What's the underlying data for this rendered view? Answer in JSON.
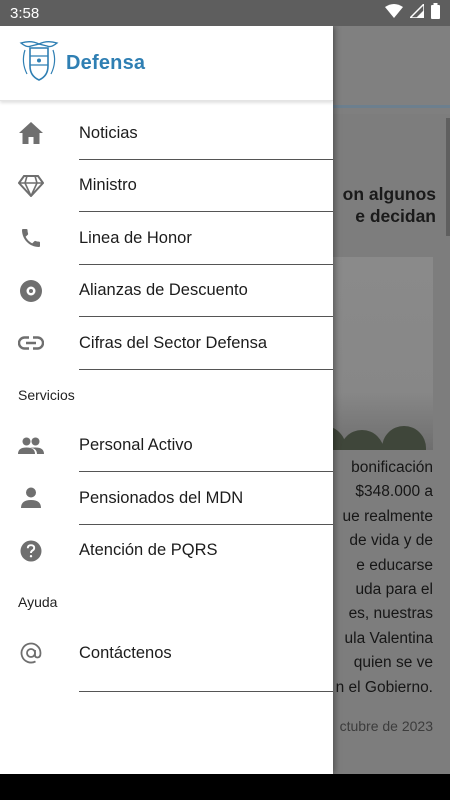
{
  "status_bar": {
    "time": "3:58"
  },
  "drawer": {
    "logo_text": "Defensa",
    "primary_items": [
      {
        "label": "Noticias",
        "icon": "home-icon"
      },
      {
        "label": "Ministro",
        "icon": "diamond-icon"
      },
      {
        "label": "Linea de Honor",
        "icon": "phone-icon"
      },
      {
        "label": "Alianzas de Descuento",
        "icon": "disc-icon"
      },
      {
        "label": "Cifras del Sector Defensa",
        "icon": "link-icon"
      }
    ],
    "servicios_label": "Servicios",
    "servicios_items": [
      {
        "label": "Personal Activo",
        "icon": "people-icon"
      },
      {
        "label": "Pensionados del MDN",
        "icon": "person-icon"
      },
      {
        "label": "Atención de PQRS",
        "icon": "help-icon"
      }
    ],
    "ayuda_label": "Ayuda",
    "ayuda_items": [
      {
        "label": "Contáctenos",
        "icon": "at-icon"
      }
    ]
  },
  "background": {
    "title_line1": "on algunos",
    "title_line2": "e decidan",
    "body_lines": [
      "bonificación",
      "$348.000 a",
      "ue realmente",
      "de vida y de",
      "e educarse",
      "uda para el",
      "es, nuestras",
      "ula Valentina",
      "quien se ve",
      "n el Gobierno."
    ],
    "date": "ctubre de 2023"
  },
  "colors": {
    "brand": "#2f7fb3",
    "icon": "#6f6f6f",
    "status_bar": "#5e5e5e"
  }
}
